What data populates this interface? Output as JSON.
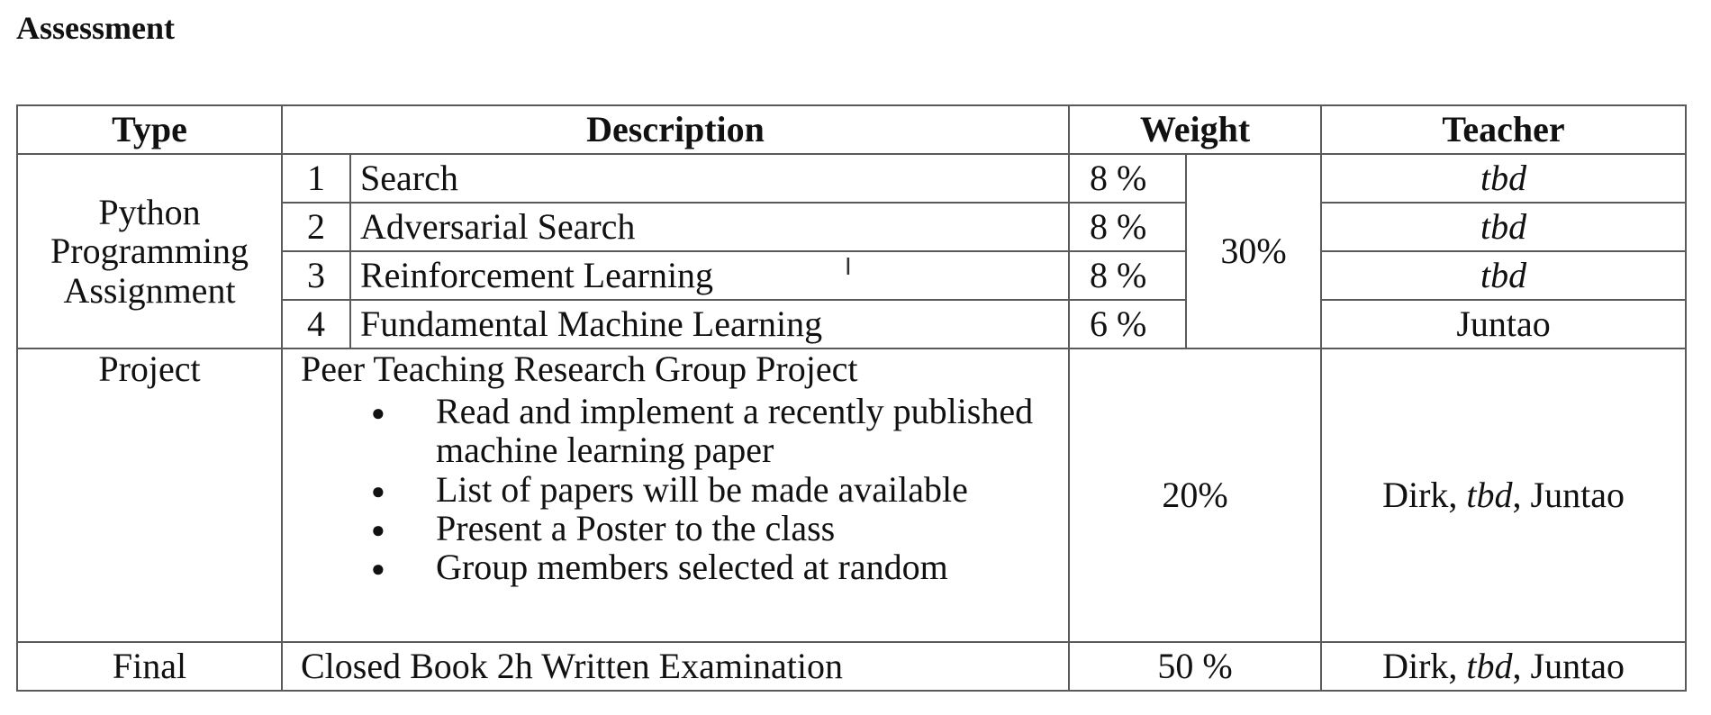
{
  "heading": "Assessment",
  "headers": {
    "type": "Type",
    "description": "Description",
    "weight": "Weight",
    "teacher": "Teacher"
  },
  "python": {
    "type_lines": [
      "Python",
      "Programming",
      "Assignment"
    ],
    "group_weight": "30%",
    "rows": [
      {
        "num": "1",
        "desc": "Search",
        "weight": "8 %",
        "teacher": "tbd"
      },
      {
        "num": "2",
        "desc": "Adversarial Search",
        "weight": "8 %",
        "teacher": "tbd"
      },
      {
        "num": "3",
        "desc": "Reinforcement Learning",
        "weight": "8 %",
        "teacher": "tbd"
      },
      {
        "num": "4",
        "desc": "Fundamental Machine Learning",
        "weight": "6 %",
        "teacher": "Juntao"
      }
    ]
  },
  "project": {
    "type": "Project",
    "title": "Peer Teaching Research Group Project",
    "bullets": [
      "Read and implement a recently published machine learning paper",
      "List of papers will be made available",
      "Present a Poster to the class",
      "Group members selected at random"
    ],
    "weight": "20%",
    "teacher_parts": [
      "Dirk, ",
      "tbd",
      ", Juntao"
    ]
  },
  "final": {
    "type": "Final",
    "desc": "Closed Book 2h Written Examination",
    "weight": "50 %",
    "teacher_parts": [
      "Dirk, ",
      "tbd",
      ", Juntao"
    ]
  }
}
